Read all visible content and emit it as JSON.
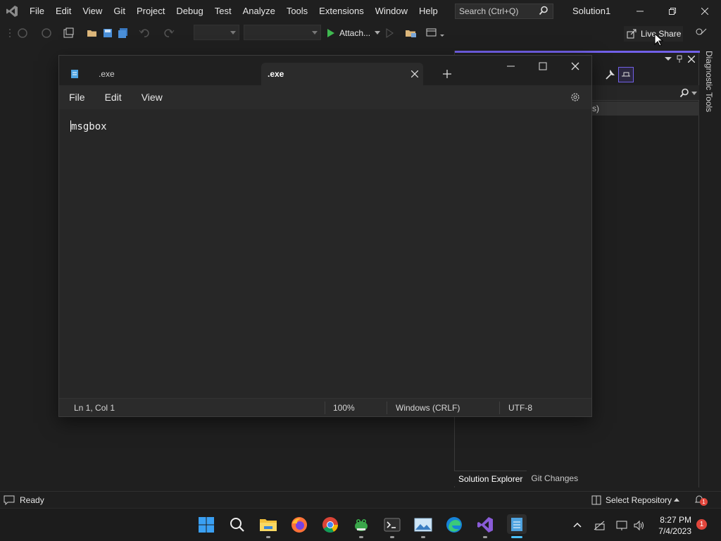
{
  "vs": {
    "menu": [
      "File",
      "Edit",
      "View",
      "Git",
      "Project",
      "Debug",
      "Test",
      "Analyze",
      "Tools",
      "Extensions",
      "Window",
      "Help"
    ],
    "search_placeholder": "Search (Ctrl+Q)",
    "solution_name": "Solution1",
    "toolbar": {
      "attach_label": "Attach...",
      "live_share_label": "Live Share"
    },
    "side_panel": {
      "vertical_label": "Diagnostic Tools",
      "row_fragment": "s)"
    },
    "bottom_tabs": [
      "Solution Explorer",
      "Git Changes"
    ],
    "status": {
      "text": "Ready",
      "repo_label": "Select Repository",
      "notification_count": "1"
    }
  },
  "notepad": {
    "tabs": [
      {
        "label": ".exe"
      },
      {
        "label": ".exe"
      }
    ],
    "menu": [
      "File",
      "Edit",
      "View"
    ],
    "content": "msgbox",
    "status": {
      "position": "Ln 1, Col 1",
      "zoom": "100%",
      "line_endings": "Windows (CRLF)",
      "encoding": "UTF-8"
    }
  },
  "taskbar": {
    "time": "8:27 PM",
    "date": "7/4/2023",
    "notification_count": "1",
    "apps": [
      "start",
      "search",
      "file-explorer",
      "firefox",
      "chrome",
      "frog-app",
      "terminal",
      "photos",
      "edge",
      "visual-studio",
      "notepad"
    ]
  },
  "colors": {
    "vs_accent": "#7160e8",
    "taskbar_active": "#4cc2ff",
    "notification_red": "#e2463c"
  }
}
